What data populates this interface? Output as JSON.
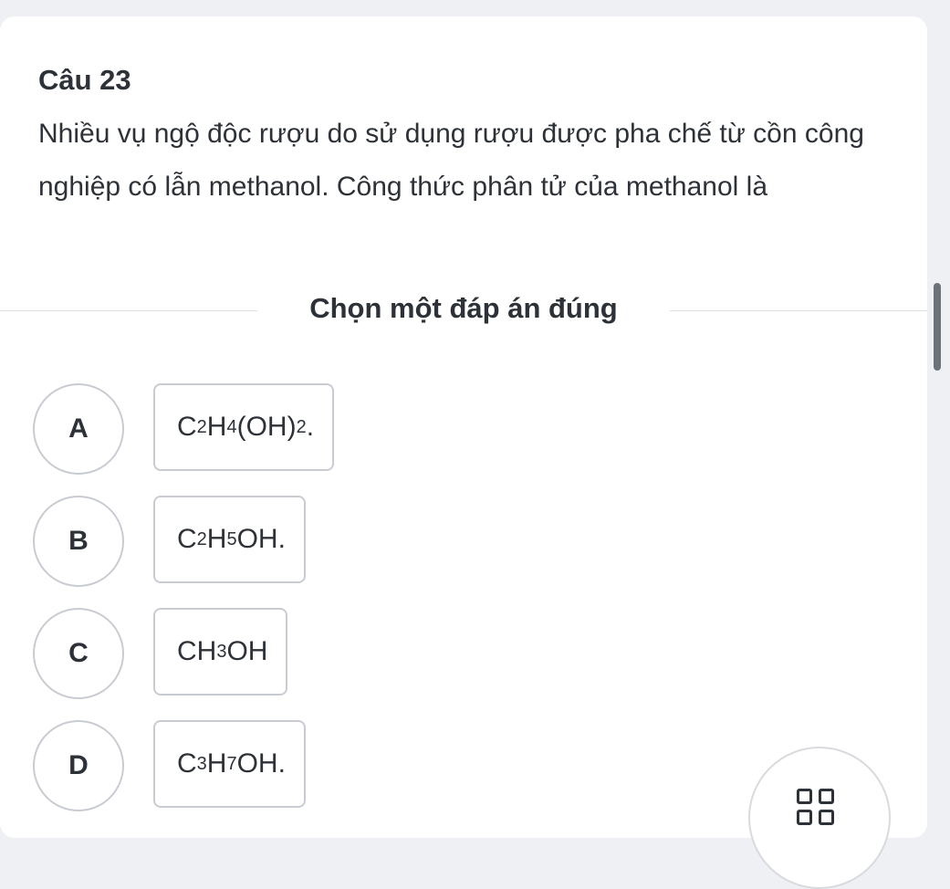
{
  "question": {
    "title": "Câu 23",
    "text": "Nhiều vụ ngộ độc rượu do sử dụng rượu được pha chế từ cồn công nghiệp có lẫn methanol. Công thức phân tử của methanol là"
  },
  "instruction": "Chọn một đáp án đúng",
  "options": [
    {
      "letter": "A",
      "formula": [
        {
          "t": "C"
        },
        {
          "s": "2"
        },
        {
          "t": "H"
        },
        {
          "s": "4"
        },
        {
          "t": "(OH)"
        },
        {
          "s": "2"
        },
        {
          "t": "."
        }
      ]
    },
    {
      "letter": "B",
      "formula": [
        {
          "t": "C"
        },
        {
          "s": "2"
        },
        {
          "t": "H"
        },
        {
          "s": "5"
        },
        {
          "t": "OH."
        }
      ]
    },
    {
      "letter": "C",
      "formula": [
        {
          "t": "CH"
        },
        {
          "s": "3"
        },
        {
          "t": "OH"
        }
      ]
    },
    {
      "letter": "D",
      "formula": [
        {
          "t": "C"
        },
        {
          "s": "3"
        },
        {
          "t": "H"
        },
        {
          "s": "7"
        },
        {
          "t": "OH."
        }
      ]
    }
  ],
  "fab": {
    "icon": "grid-icon"
  }
}
